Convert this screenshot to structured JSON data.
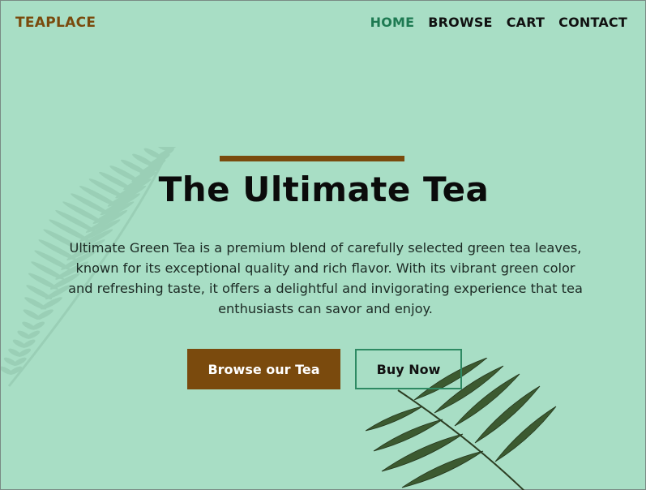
{
  "brand": {
    "name": "TEAPLACE",
    "color": "#7a4a0d"
  },
  "nav": {
    "items": [
      {
        "label": "HOME",
        "active": true
      },
      {
        "label": "BROWSE",
        "active": false
      },
      {
        "label": "CART",
        "active": false
      },
      {
        "label": "CONTACT",
        "active": false
      }
    ],
    "active_color": "#1e7a52"
  },
  "hero": {
    "title": "The Ultimate Tea",
    "description": "Ultimate Green Tea is a premium blend of carefully selected green tea leaves, known for its exceptional quality and rich flavor. With its vibrant green color and refreshing taste, it offers a delightful and invigorating experience that tea enthusiasts can savor and enjoy.",
    "primary_button": "Browse our Tea",
    "secondary_button": "Buy Now"
  },
  "colors": {
    "background": "#a8dec5",
    "accent": "#7a4a0d",
    "outline": "#2e8a63"
  },
  "decorations": [
    "fern-leaf-icon",
    "palm-leaf-icon"
  ]
}
